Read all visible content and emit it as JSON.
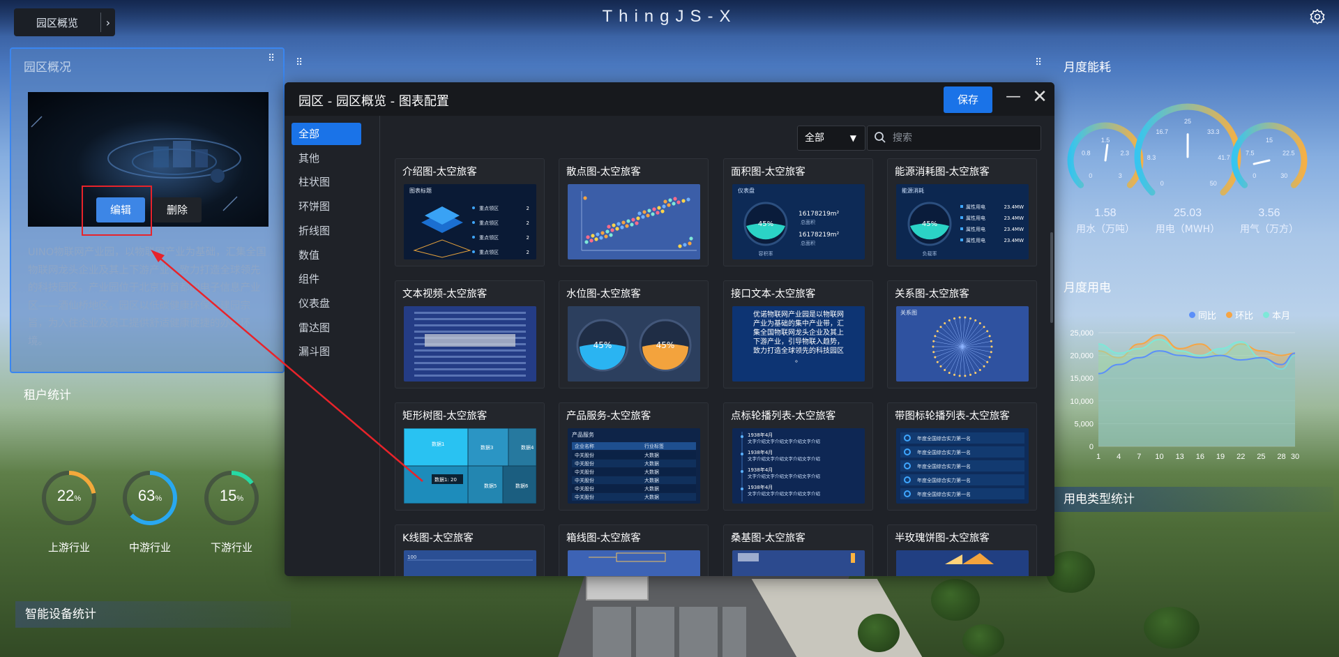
{
  "app_title": "ThingJS-X",
  "nav": {
    "label": "园区概览",
    "chevron": "›"
  },
  "left_panel": {
    "title": "园区概况",
    "edit_label": "编辑",
    "delete_label": "删除",
    "description": "UINO物联网产业园，以物联网产业为基础，汇集全国物联网龙头企业及其上下游产业，致力打造全球领先的科技园区。产业园位于北京市首都的电子信息产业区——酒仙桥地区。园区以低碳健康环保为建园宗旨，为入住企业及员工提供舒适健康便捷的办公环境。"
  },
  "tenant": {
    "title": "租户统计",
    "items": [
      {
        "value": "22",
        "unit": "%",
        "label": "上游行业",
        "pct": 0.22,
        "color": "#f3a93b"
      },
      {
        "value": "63",
        "unit": "%",
        "label": "中游行业",
        "pct": 0.63,
        "color": "#29a8f0"
      },
      {
        "value": "15",
        "unit": "%",
        "label": "下游行业",
        "pct": 0.15,
        "color": "#27d9a4"
      }
    ]
  },
  "device_title": "智能设备统计",
  "right": {
    "energy_title": "月度能耗",
    "gauges": [
      {
        "value": "1.58",
        "label": "用水（万吨）",
        "ticks": [
          "0",
          "0.8",
          "1.5",
          "2.3",
          "3"
        ]
      },
      {
        "value": "25.03",
        "label": "用电（MWH）",
        "ticks": [
          "0",
          "8.3",
          "16.7",
          "25",
          "33.3",
          "41.7",
          "50"
        ]
      },
      {
        "value": "3.56",
        "label": "用气（万方）",
        "ticks": [
          "0",
          "7.5",
          "15",
          "22.5",
          "30"
        ]
      }
    ],
    "power_title": "月度用电",
    "power_type_title": "用电类型统计",
    "legend": [
      {
        "name": "同比",
        "color": "#5b8ff9"
      },
      {
        "name": "环比",
        "color": "#f6a544"
      },
      {
        "name": "本月",
        "color": "#7ee8d8"
      }
    ]
  },
  "chart_data": {
    "type": "area",
    "x": [
      1,
      4,
      7,
      10,
      13,
      16,
      19,
      22,
      25,
      28,
      30
    ],
    "y_ticks": [
      "0",
      "5,000",
      "10,000",
      "15,000",
      "20,000",
      "25,000"
    ],
    "ylim": [
      0,
      25000
    ],
    "series": [
      {
        "name": "同比",
        "values": [
          16000,
          18000,
          19500,
          21000,
          20000,
          19500,
          20000,
          19000,
          19500,
          18000,
          20500
        ]
      },
      {
        "name": "环比",
        "values": [
          21000,
          19500,
          22500,
          24500,
          21500,
          22500,
          20000,
          22500,
          21000,
          20000,
          20500
        ]
      },
      {
        "name": "本月",
        "values": [
          22500,
          20500,
          21500,
          23500,
          21000,
          20000,
          21500,
          23000,
          19500,
          17000,
          20000
        ]
      }
    ]
  },
  "modal": {
    "title": "园区 - 园区概览 - 图表配置",
    "save_label": "保存",
    "minimize": "—",
    "close": "✕",
    "categories": [
      "全部",
      "其他",
      "柱状图",
      "环饼图",
      "折线图",
      "数值",
      "组件",
      "仪表盘",
      "雷达图",
      "漏斗图"
    ],
    "filter_value": "全部",
    "search_placeholder": "搜索",
    "cards": [
      {
        "title": "介绍图-太空旅客",
        "kind": "intro",
        "pv": {
          "title": "图表标题",
          "rows": [
            "重点领区",
            "重点领区",
            "重点领区",
            "重点领区"
          ],
          "num": "2"
        }
      },
      {
        "title": "散点图-太空旅客",
        "kind": "scatter"
      },
      {
        "title": "面积图-太空旅客",
        "kind": "area",
        "pv": {
          "title": "仪表盘",
          "pct": "45%",
          "v1": "16178219m²",
          "l1": "总面积",
          "v2": "16178219m²",
          "l2": "总面积",
          "foot": "容积率"
        }
      },
      {
        "title": "能源消耗图-太空旅客",
        "kind": "energy",
        "pv": {
          "title": "能源消耗",
          "pct": "45%",
          "row": "属性用电",
          "val": "23.4MW",
          "foot": "负载率"
        }
      },
      {
        "title": "文本视频-太空旅客",
        "kind": "video"
      },
      {
        "title": "水位图-太空旅客",
        "kind": "water",
        "pv": {
          "a": "45%",
          "b": "45%"
        }
      },
      {
        "title": "接口文本-太空旅客",
        "kind": "text",
        "pv": {
          "text": "优诺物联网产业园是以物联网产业为基础的集中产业带，汇集全国物联网龙头企业及其上下游产业，引导物联入趋势，致力打造全球领先的科技园区。"
        }
      },
      {
        "title": "关系图-太空旅客",
        "kind": "relation",
        "pv": {
          "title": "关系图"
        }
      },
      {
        "title": "矩形树图-太空旅客",
        "kind": "treemap",
        "pv": {
          "labels": [
            "数据1",
            "数据3",
            "数据4",
            "数据5",
            "数据6"
          ],
          "tip": "数据1: 20"
        }
      },
      {
        "title": "产品服务-太空旅客",
        "kind": "product",
        "pv": {
          "title": "产品服务",
          "h1": "企业名称",
          "h2": "行业标签",
          "c1": "中关股份",
          "c2": "大数据"
        }
      },
      {
        "title": "点标轮播列表-太空旅客",
        "kind": "timeline",
        "pv": {
          "date": "1938年4月",
          "text": "文字介绍文字介绍文字介绍文字介绍"
        }
      },
      {
        "title": "带图标轮播列表-太空旅客",
        "kind": "iconlist",
        "pv": {
          "text": "年度全国综合实力第一名"
        }
      },
      {
        "title": "K线图-太空旅客",
        "kind": "kline",
        "pv": {
          "label": "100"
        }
      },
      {
        "title": "箱线图-太空旅客",
        "kind": "box"
      },
      {
        "title": "桑基图-太空旅客",
        "kind": "sankey"
      },
      {
        "title": "半玫瑰饼图-太空旅客",
        "kind": "rose"
      }
    ]
  }
}
